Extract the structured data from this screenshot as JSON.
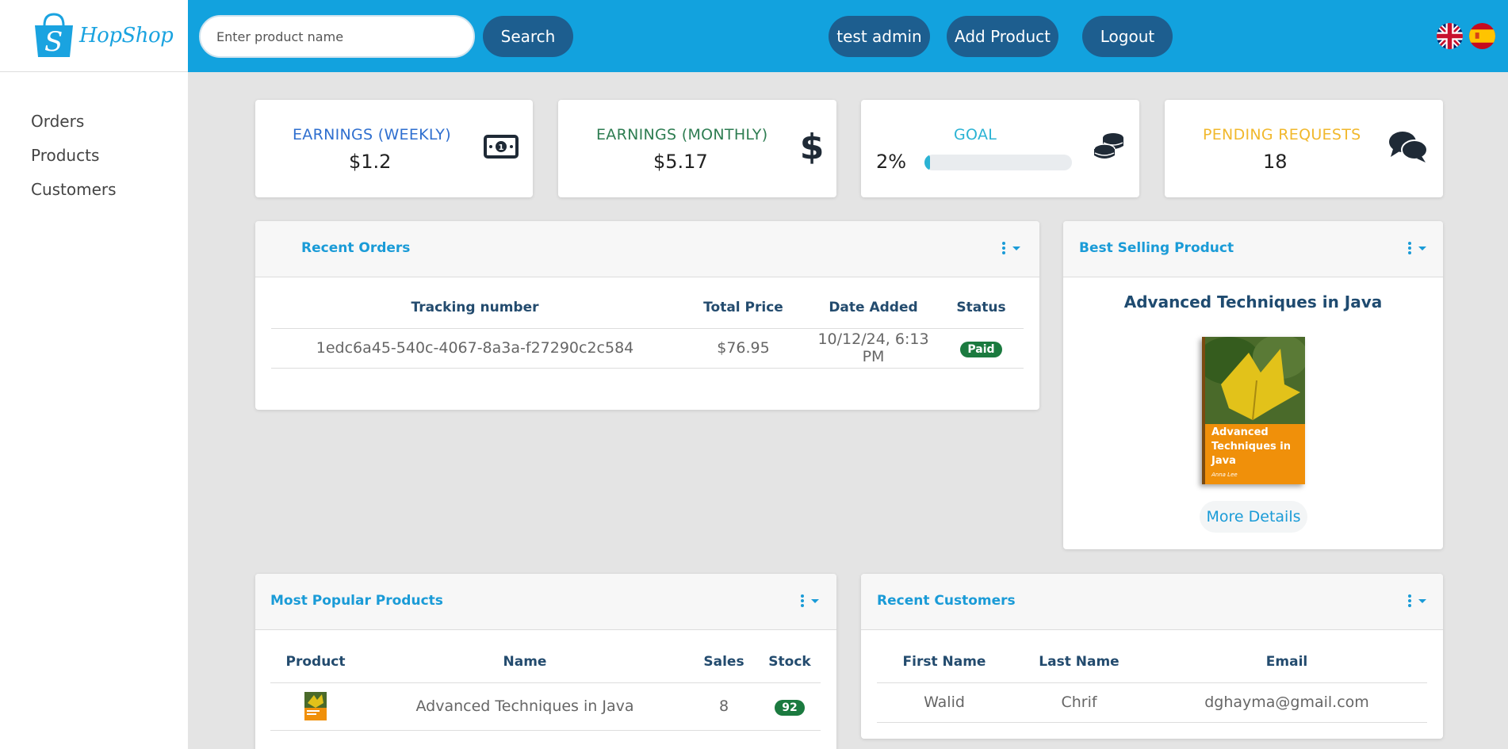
{
  "brand": {
    "name": "HopShop"
  },
  "sidebar": {
    "items": [
      {
        "label": "Orders"
      },
      {
        "label": "Products"
      },
      {
        "label": "Customers"
      }
    ]
  },
  "header": {
    "search_placeholder": "Enter product name",
    "search_label": "Search",
    "user_label": "test admin",
    "add_product_label": "Add Product",
    "logout_label": "Logout",
    "languages": [
      "en-flag-icon",
      "es-flag-icon"
    ]
  },
  "stats": {
    "weekly": {
      "title": "EARNINGS (WEEKLY)",
      "value": "$1.2",
      "color": "#2f6fcf"
    },
    "monthly": {
      "title": "EARNINGS (MONTHLY)",
      "value": "$5.17",
      "color": "#2e7d52"
    },
    "goal": {
      "title": "GOAL",
      "value": "2%",
      "progress": 0.02,
      "color": "#2bb3d4"
    },
    "pending": {
      "title": "PENDING REQUESTS",
      "value": "18",
      "color": "#f1b82d"
    }
  },
  "recent_orders": {
    "title": "Recent Orders",
    "columns": [
      "Tracking number",
      "Total Price",
      "Date Added",
      "Status"
    ],
    "rows": [
      {
        "tracking": "1edc6a45-540c-4067-8a3a-f27290c2c584",
        "price": "$76.95",
        "date": "10/12/24, 6:13 PM",
        "status": "Paid"
      }
    ]
  },
  "best_selling": {
    "title": "Best Selling Product",
    "product_name": "Advanced Techniques in Java",
    "cover_title": "Advanced Techniques in Java",
    "cover_author": "Anna Lee",
    "more_details_label": "More Details"
  },
  "popular_products": {
    "title": "Most Popular Products",
    "columns": [
      "Product",
      "Name",
      "Sales",
      "Stock"
    ],
    "rows": [
      {
        "name": "Advanced Techniques in Java",
        "sales": "8",
        "stock": "92"
      }
    ]
  },
  "recent_customers": {
    "title": "Recent Customers",
    "columns": [
      "First Name",
      "Last Name",
      "Email"
    ],
    "rows": [
      {
        "first": "Walid",
        "last": "Chrif",
        "email": "dghayma@gmail.com"
      }
    ]
  },
  "colors": {
    "topbar": "#12a2de",
    "button": "#1d5e8f",
    "accent": "#1a9bd7",
    "paid": "#1b7a3f"
  }
}
